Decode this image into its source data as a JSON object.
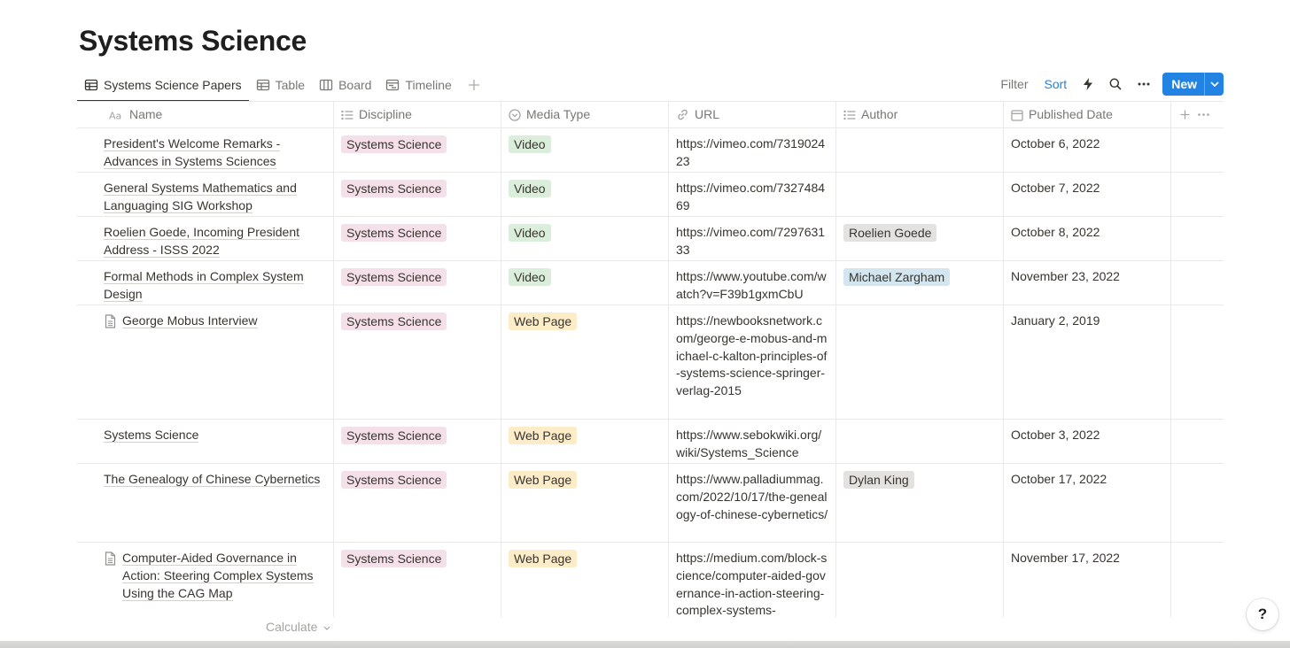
{
  "page": {
    "title": "Systems Science"
  },
  "views": [
    {
      "label": "Systems Science Papers",
      "icon": "table-icon",
      "active": true
    },
    {
      "label": "Table",
      "icon": "table-icon"
    },
    {
      "label": "Board",
      "icon": "board-icon"
    },
    {
      "label": "Timeline",
      "icon": "timeline-icon"
    }
  ],
  "actions": {
    "filter": "Filter",
    "sort": "Sort",
    "new": "New"
  },
  "columns": {
    "name": "Name",
    "discipline": "Discipline",
    "media_type": "Media Type",
    "url": "URL",
    "author": "Author",
    "published_date": "Published Date"
  },
  "rows": [
    {
      "name": "President's Welcome Remarks - Advances in Systems Sciences",
      "doc_icon": false,
      "discipline": "Systems Science",
      "media": "Video",
      "url": "https://vimeo.com/731902423",
      "author": "",
      "date": "October 6, 2022"
    },
    {
      "name": "General Systems Mathematics and Languaging SIG Workshop",
      "doc_icon": false,
      "discipline": "Systems Science",
      "media": "Video",
      "url": "https://vimeo.com/732748469",
      "author": "",
      "date": "October 7, 2022"
    },
    {
      "name": "Roelien Goede, Incoming President Address - ISSS 2022",
      "doc_icon": false,
      "discipline": "Systems Science",
      "media": "Video",
      "url": "https://vimeo.com/729763133",
      "author": "Roelien Goede",
      "date": "October 8, 2022"
    },
    {
      "name": "Formal Methods in Complex System Design",
      "doc_icon": false,
      "discipline": "Systems Science",
      "media": "Video",
      "url": "https://www.youtube.com/watch?v=F39b1gxmCbU",
      "author": "Michael Zargham",
      "date": "November 23, 2022"
    },
    {
      "name": "George Mobus Interview",
      "doc_icon": true,
      "discipline": "Systems Science",
      "media": "Web Page",
      "url": "https://newbooksnetwork.com/george-e-mobus-and-michael-c-kalton-principles-of-systems-science-springer-verlag-2015",
      "author": "",
      "date": "January 2, 2019"
    },
    {
      "name": "Systems Science",
      "doc_icon": false,
      "discipline": "Systems Science",
      "media": "Web Page",
      "url": "https://www.sebokwiki.org/wiki/Systems_Science",
      "author": "",
      "date": "October 3, 2022"
    },
    {
      "name": "The Genealogy of Chinese Cybernetics",
      "doc_icon": false,
      "discipline": "Systems Science",
      "media": "Web Page",
      "url": "https://www.palladiummag.com/2022/10/17/the-genealogy-of-chinese-cybernetics/",
      "author": "Dylan King",
      "date": "October 17, 2022"
    },
    {
      "name": "Computer-Aided Governance in Action: Steering Complex Systems Using the CAG Map",
      "doc_icon": true,
      "discipline": "Systems Science",
      "media": "Web Page",
      "url": "https://medium.com/block-science/computer-aided-governance-in-action-steering-complex-systems-",
      "author": "",
      "date": "November 17, 2022"
    }
  ],
  "footer": {
    "calculate": "Calculate"
  },
  "help": {
    "label": "?"
  },
  "colors": {
    "accent": "#2383e2",
    "tag_systems_science": "#f5e0e9",
    "tag_video": "#dbeddb",
    "tag_web_page": "#fdecc8",
    "author_roelien": "#e3e2e0",
    "author_michael": "#d3e5ef",
    "author_dylan": "#e3e2e0"
  }
}
